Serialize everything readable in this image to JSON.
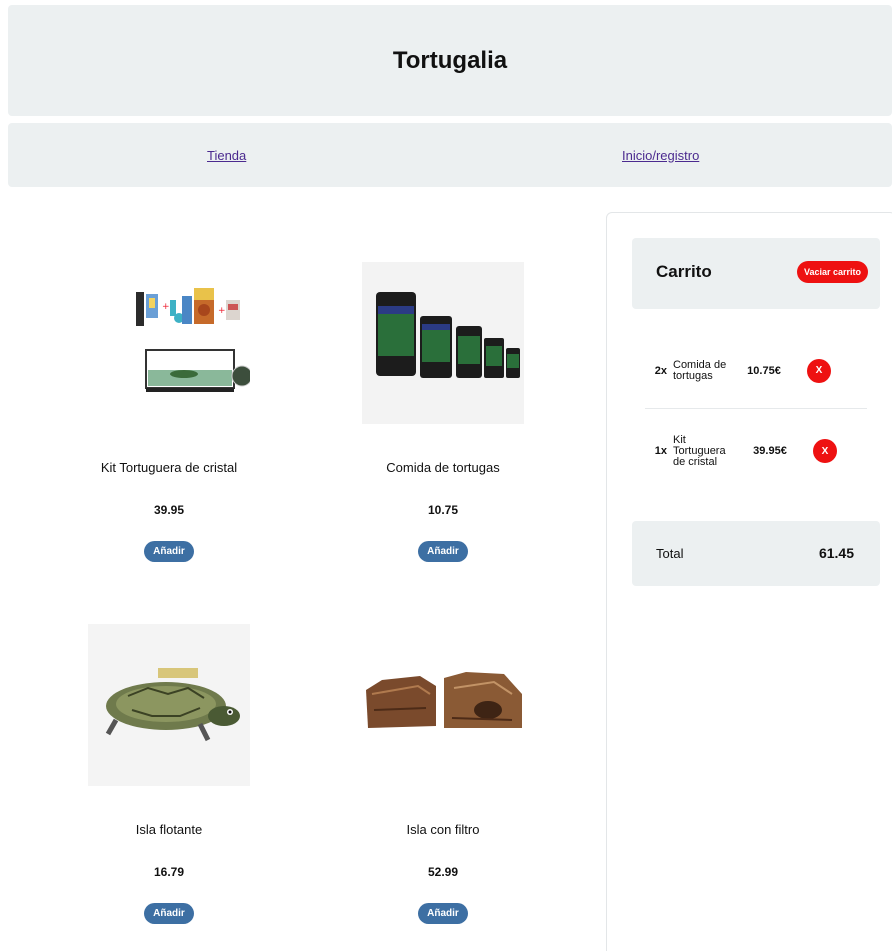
{
  "header": {
    "title": "Tortugalia"
  },
  "nav": {
    "shop": "Tienda",
    "login": "Inicio/registro"
  },
  "products": [
    {
      "name": "Kit Tortuguera de cristal",
      "price": "39.95",
      "add_label": "Añadir"
    },
    {
      "name": "Comida de tortugas",
      "price": "10.75",
      "add_label": "Añadir"
    },
    {
      "name": "Isla flotante",
      "price": "16.79",
      "add_label": "Añadir"
    },
    {
      "name": "Isla con filtro",
      "price": "52.99",
      "add_label": "Añadir"
    }
  ],
  "cart": {
    "title": "Carrito",
    "empty_label": "Vaciar carrito",
    "items": [
      {
        "qty": "2x",
        "name": "Comida de tortugas",
        "price": "10.75€",
        "remove_label": "X"
      },
      {
        "qty": "1x",
        "name": "Kit Tortuguera de cristal",
        "price": "39.95€",
        "remove_label": "X"
      }
    ],
    "total_label": "Total",
    "total_value": "61.45"
  },
  "colors": {
    "panel_bg": "#ecf0f1",
    "add_button": "#3d6fa3",
    "danger": "#ee1111",
    "link": "#4b2a8f"
  },
  "icons": [
    "terrarium-kit-image",
    "turtle-food-image",
    "floating-island-image",
    "filter-island-image"
  ]
}
